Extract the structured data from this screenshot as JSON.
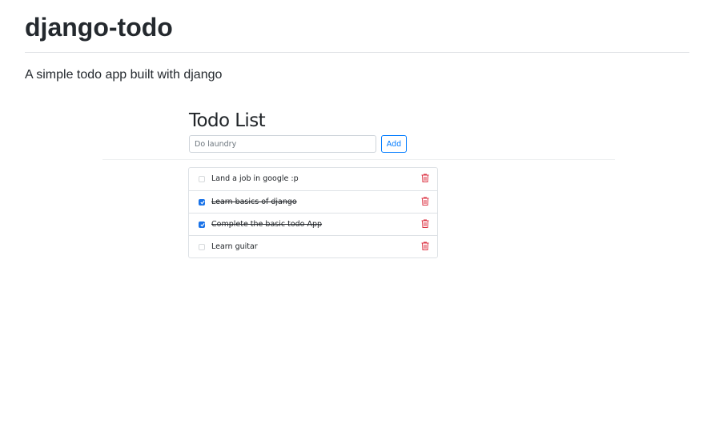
{
  "page": {
    "title": "django-todo",
    "description": "A simple todo app built with django"
  },
  "app": {
    "heading": "Todo List",
    "input_placeholder": "Do laundry",
    "add_label": "Add"
  },
  "todos": [
    {
      "text": "Land a job in google :p",
      "completed": false
    },
    {
      "text": "Learn basics of django",
      "completed": true
    },
    {
      "text": "Complete the basic todo App",
      "completed": true
    },
    {
      "text": "Learn guitar",
      "completed": false
    }
  ],
  "colors": {
    "accent": "#007bff",
    "checkbox_checked": "#1a73e8",
    "delete": "#dc3545"
  },
  "icons": {
    "delete": "trash-icon",
    "checkmark": "check-icon"
  }
}
